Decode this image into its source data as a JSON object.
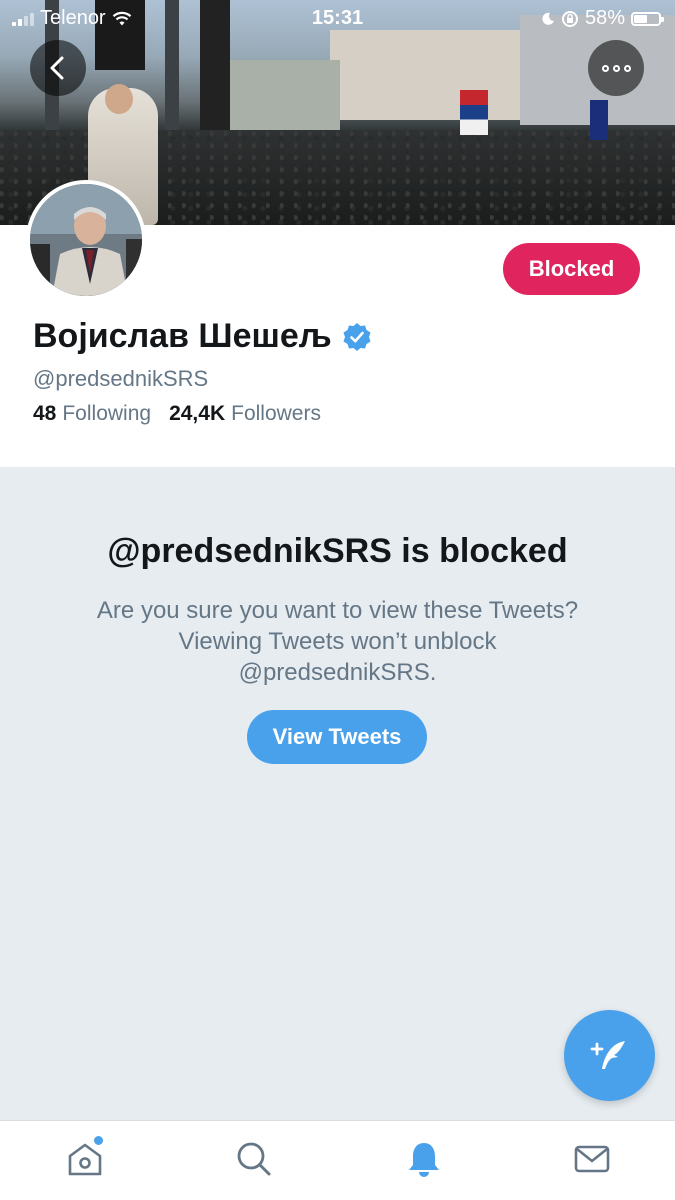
{
  "status_bar": {
    "carrier": "Telenor",
    "time": "15:31",
    "battery_percent": "58%",
    "battery_level": 0.58
  },
  "header": {
    "back_icon": "chevron-left-icon",
    "more_icon": "more-dots-icon"
  },
  "profile": {
    "name": "Војислав Шешељ",
    "handle": "@predsednikSRS",
    "verified": true,
    "following_count": "48",
    "following_label": "Following",
    "followers_count": "24,4K",
    "followers_label": "Followers",
    "blocked_button_label": "Blocked"
  },
  "blocked_notice": {
    "title": "@predsednikSRS is blocked",
    "line1": "Are you sure you want to view these Tweets?",
    "line2": "Viewing Tweets won’t unblock",
    "line3": "@predsednikSRS.",
    "view_button_label": "View Tweets"
  },
  "tabs": [
    {
      "name": "home",
      "icon": "home-icon",
      "has_notification_dot": true
    },
    {
      "name": "search",
      "icon": "search-icon"
    },
    {
      "name": "notifications",
      "icon": "bell-icon",
      "active": true
    },
    {
      "name": "messages",
      "icon": "mail-icon"
    }
  ],
  "colors": {
    "accent": "#4aa1eb",
    "blocked": "#e0245e",
    "muted_text": "#657786",
    "background_grey": "#e6ecf0"
  }
}
